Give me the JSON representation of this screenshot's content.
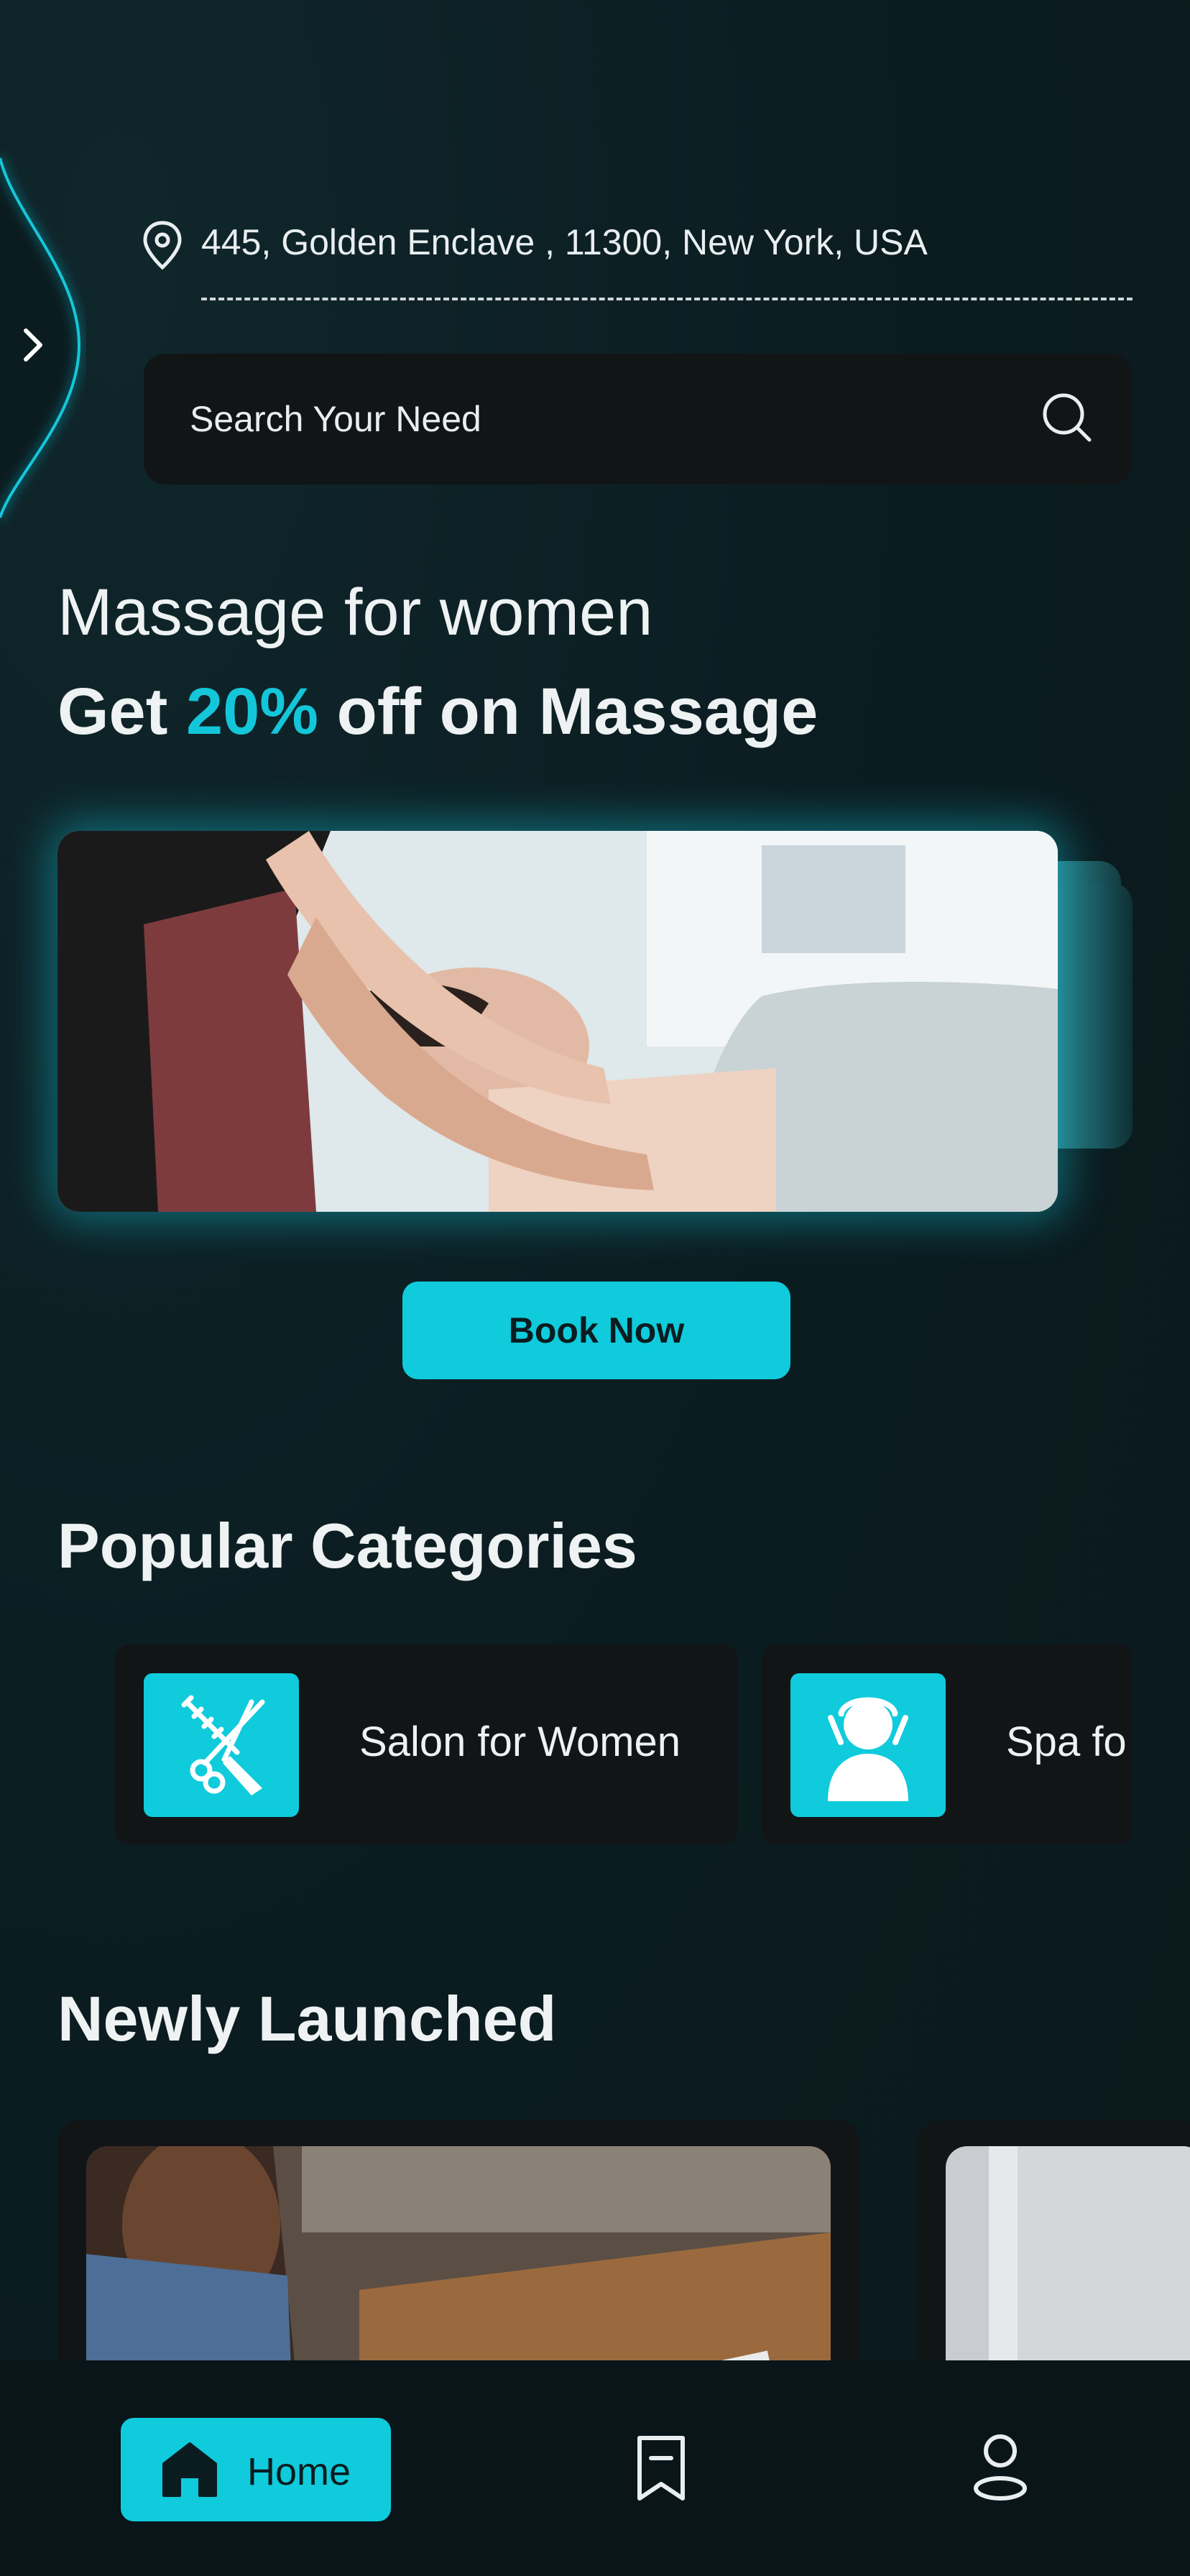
{
  "location": {
    "address": "445,  Golden Enclave , 11300, New York, USA"
  },
  "search": {
    "placeholder": "Search Your Need"
  },
  "promo": {
    "subtitle": "Massage for women",
    "title_prefix": "Get ",
    "title_accent": "20%",
    "title_suffix": " off on Massage",
    "cta": "Book Now"
  },
  "categories": {
    "title": "Popular Categories",
    "items": [
      {
        "label": "Salon for Women",
        "icon": "scissors-comb-icon"
      },
      {
        "label": "Spa fo",
        "icon": "spa-face-icon"
      }
    ]
  },
  "newly_launched": {
    "title": "Newly Launched"
  },
  "nav": {
    "home": "Home",
    "bookmark_icon": "bookmark-icon",
    "profile_icon": "user-icon"
  },
  "colors": {
    "accent": "#0fcbdc",
    "background": "#0b1c20",
    "card": "#111516"
  }
}
